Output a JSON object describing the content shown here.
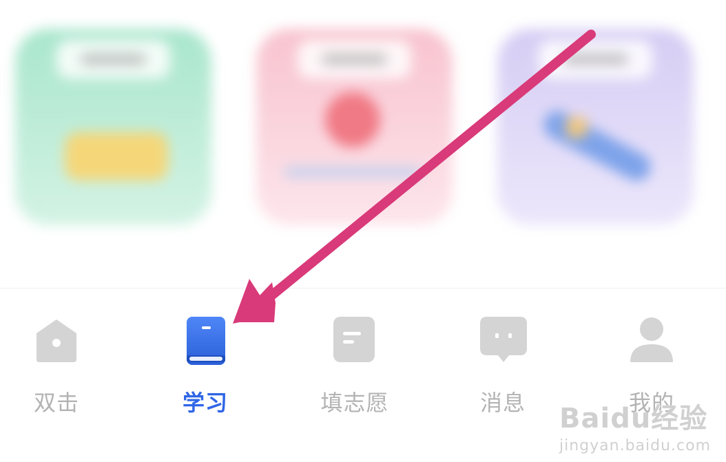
{
  "tabbar": {
    "items": [
      {
        "label": "双击",
        "icon": "home-icon",
        "active": false
      },
      {
        "label": "学习",
        "icon": "book-icon",
        "active": true
      },
      {
        "label": "填志愿",
        "icon": "form-icon",
        "active": false
      },
      {
        "label": "消息",
        "icon": "message-icon",
        "active": false
      },
      {
        "label": "我的",
        "icon": "profile-icon",
        "active": false
      }
    ]
  },
  "watermark": {
    "brand": "Baidu经验",
    "url": "jingyan.baidu.com"
  },
  "colors": {
    "active": "#2f66e6",
    "inactive": "#b3b3b3",
    "arrow": "#d93a79"
  }
}
